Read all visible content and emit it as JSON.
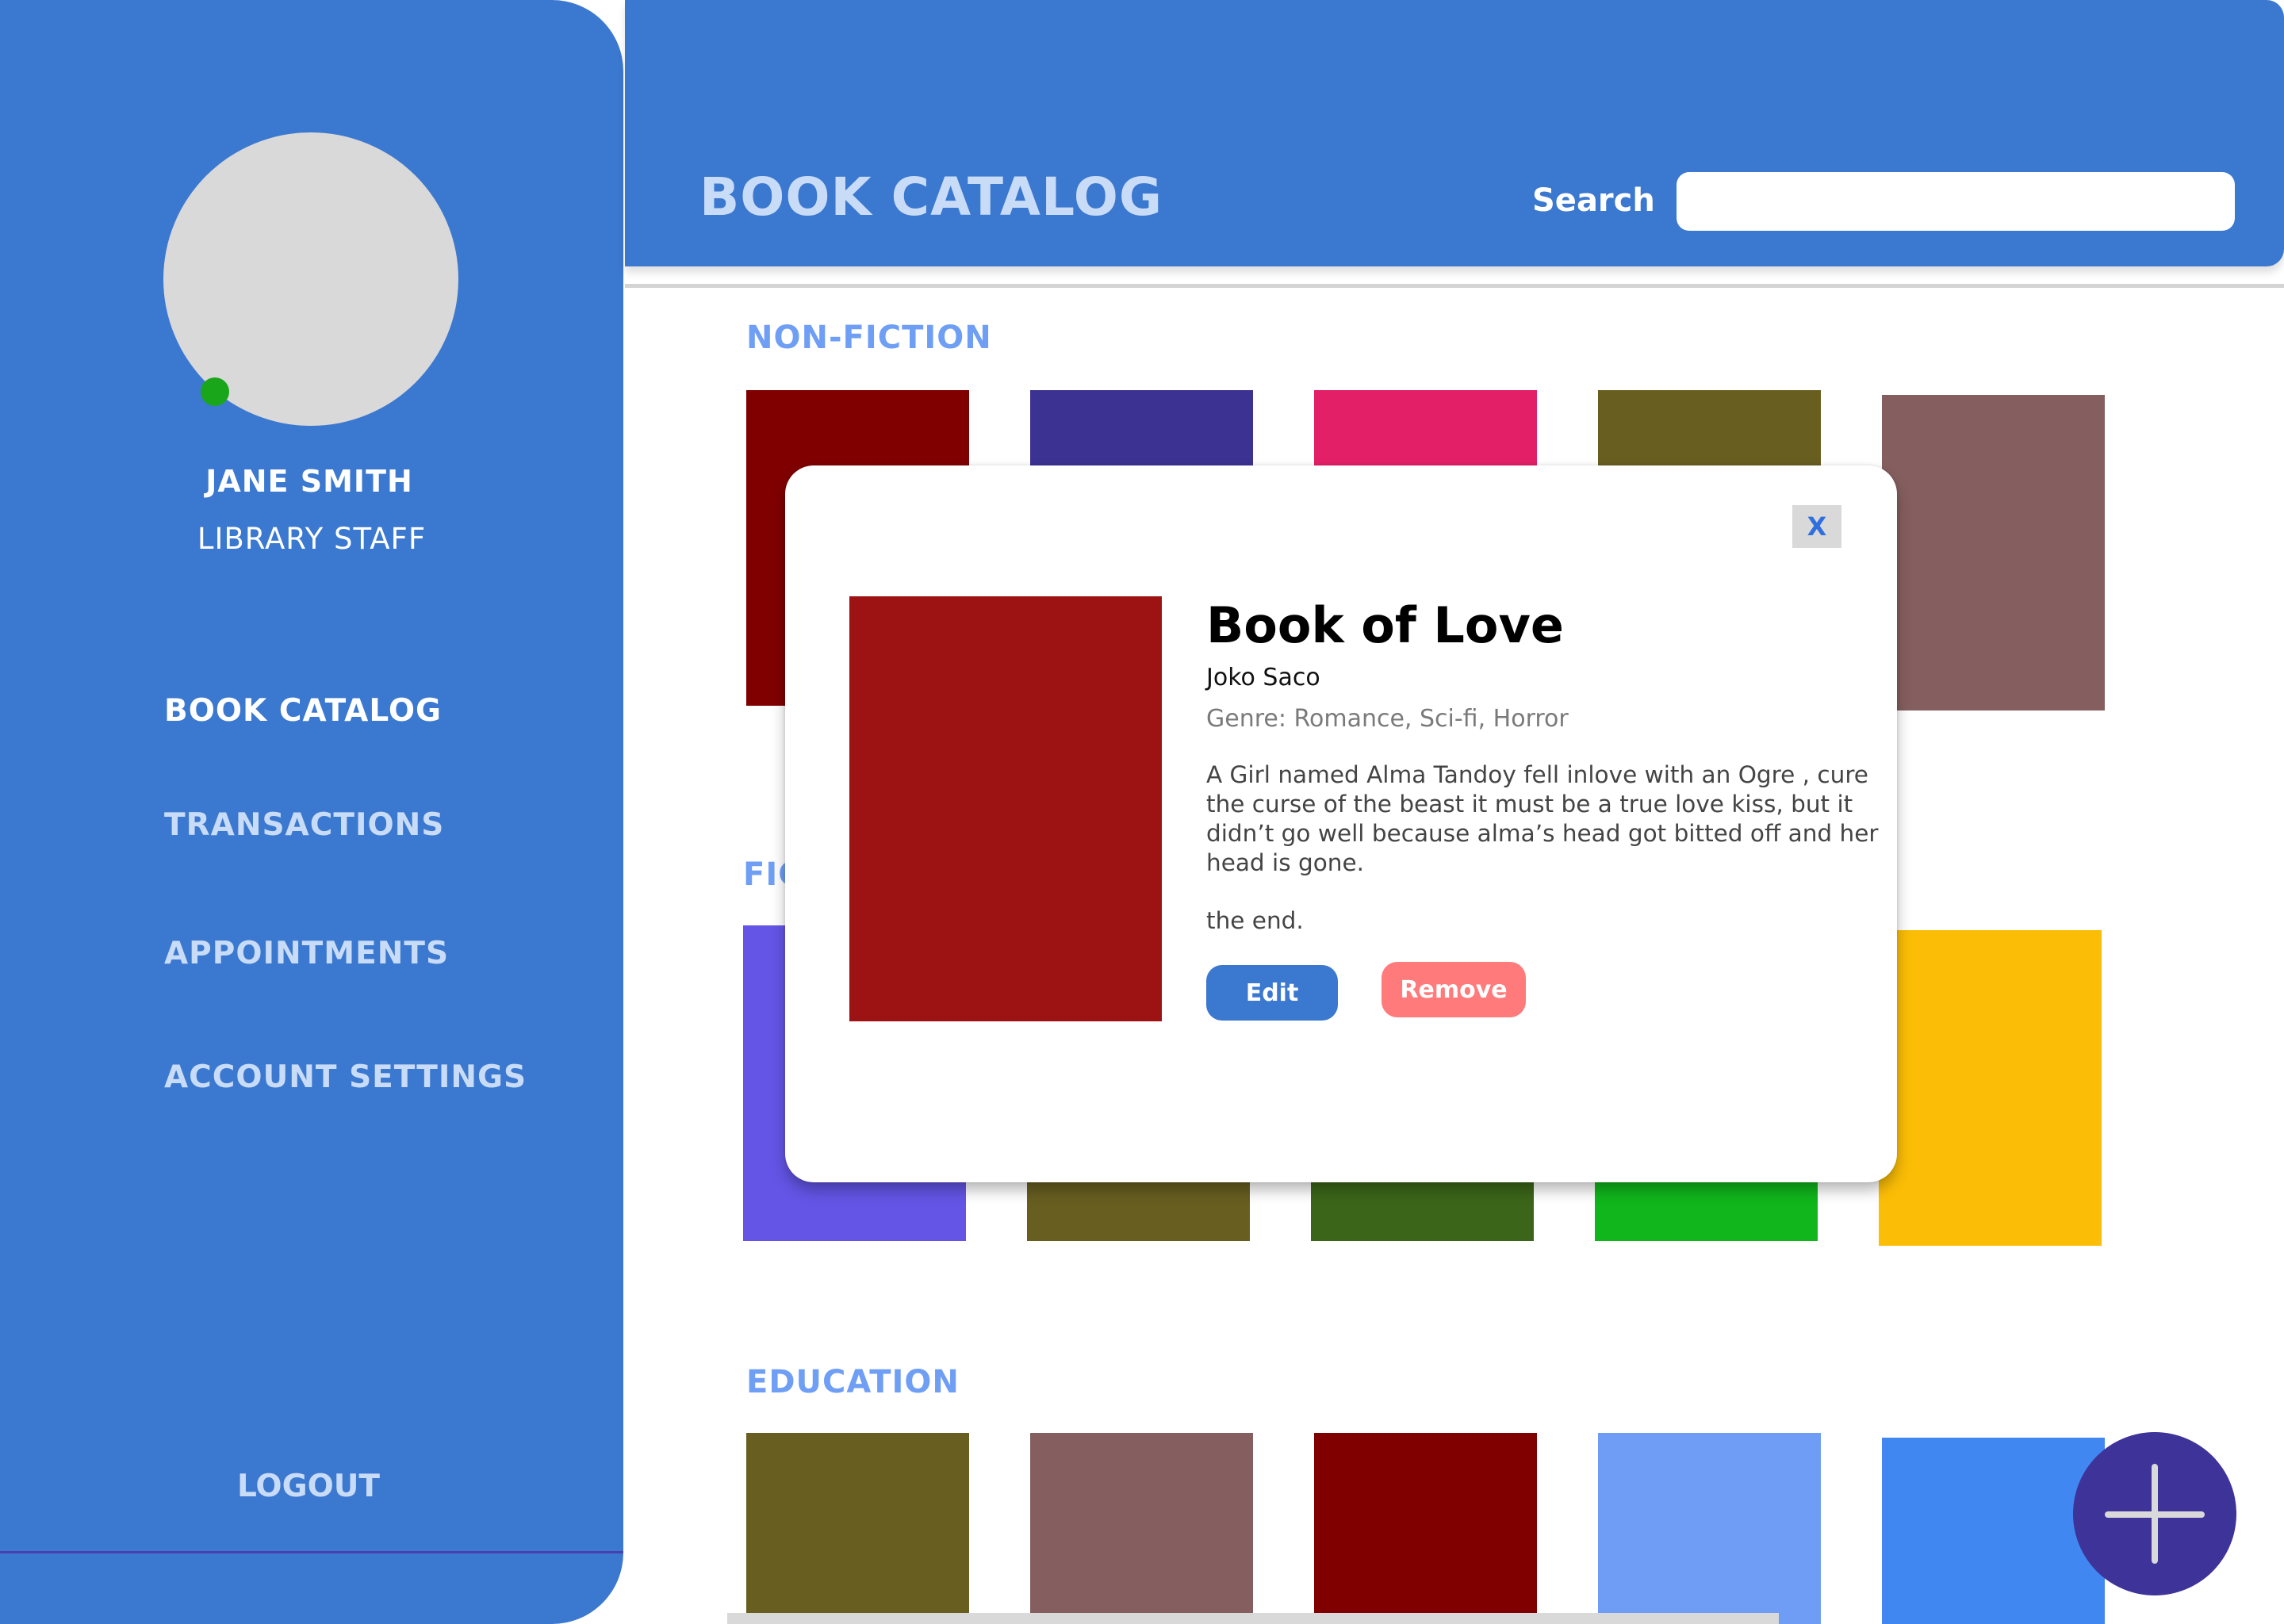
{
  "sidebar": {
    "user_name": "JANE SMITH",
    "user_role": "LIBRARY STAFF",
    "status": "online",
    "nav": [
      {
        "label": "BOOK CATALOG",
        "active": true
      },
      {
        "label": "TRANSACTIONS",
        "active": false
      },
      {
        "label": "APPOINTMENTS",
        "active": false
      },
      {
        "label": "ACCOUNT SETTINGS",
        "active": false
      }
    ],
    "logout_label": "LOGOUT"
  },
  "header": {
    "title": "BOOK CATALOG",
    "search_label": "Search",
    "search_value": ""
  },
  "sections": [
    {
      "title": "NON-FICTION",
      "books": [
        "#800000",
        "#3c3292",
        "#e31f68",
        "#675e20",
        "#855f5f"
      ]
    },
    {
      "title": "FIC",
      "books": [
        "#6455e6",
        "#675e20",
        "#3b6619",
        "#10b61b",
        "#fbbd06"
      ]
    },
    {
      "title": "EDUCATION",
      "books": [
        "#675e20",
        "#855f5f",
        "#800000",
        "#6f9df6",
        "#4187f2"
      ]
    }
  ],
  "modal": {
    "close_label": "X",
    "cover_color": "#9d1212",
    "title": "Book of Love",
    "author": "Joko Saco",
    "genre": "Genre: Romance, Sci-fi, Horror",
    "description": [
      "A Girl named Alma Tandoy fell inlove with an Ogre , cure the curse of the beast it must be a true love kiss, but it didn’t go well because alma’s head got bitted off and her head is gone.",
      "the end."
    ],
    "edit_label": "Edit",
    "remove_label": "Remove"
  },
  "fab_icon": "plus-icon",
  "colors": {
    "primary": "#3b78d0",
    "accent": "#3d3399",
    "section_title": "#6f9ef5",
    "remove": "#ff7a7a"
  }
}
